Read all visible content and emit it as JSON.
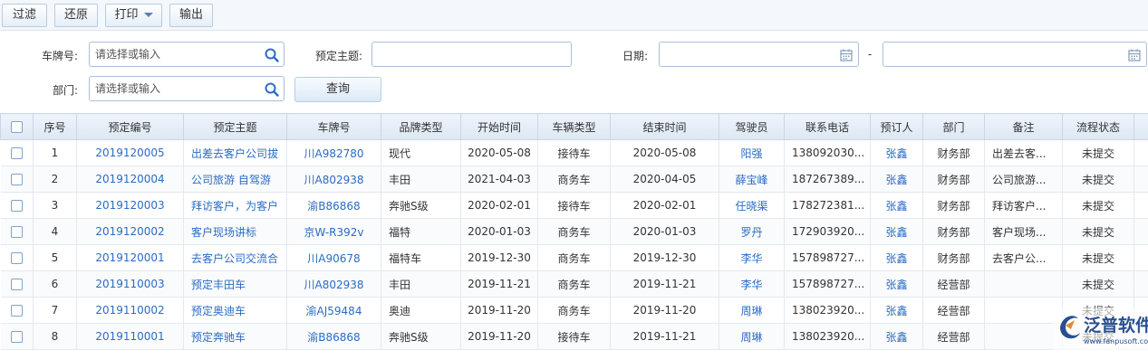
{
  "toolbar": {
    "filter_label": "过滤",
    "restore_label": "还原",
    "print_label": "打印",
    "export_label": "输出"
  },
  "filters": {
    "plate_label": "车牌号:",
    "plate_placeholder": "请选择或输入",
    "subject_label": "预定主题:",
    "subject_value": "",
    "date_label": "日期:",
    "date_separator": "-",
    "date_from": "",
    "date_to": "",
    "dept_label": "部门:",
    "dept_placeholder": "请选择或输入",
    "query_label": "查询"
  },
  "table": {
    "columns": [
      "序号",
      "预定编号",
      "预定主题",
      "车牌号",
      "品牌类型",
      "开始时间",
      "车辆类型",
      "结束时间",
      "驾驶员",
      "联系电话",
      "预订人",
      "部门",
      "备注",
      "流程状态"
    ],
    "rows": [
      {
        "no": "1",
        "code": "2019120005",
        "subject": "出差去客户公司拔",
        "plate": "川A982780",
        "brand": "现代",
        "start": "2020-05-08",
        "vtype": "接待车",
        "end": "2020-05-08",
        "driver": "阳强",
        "phone": "138092030...",
        "booker": "张鑫",
        "dept": "财务部",
        "note": "出差去客...",
        "status": "未提交"
      },
      {
        "no": "2",
        "code": "2019120004",
        "subject": "公司旅游 自驾游",
        "plate": "川A802938",
        "brand": "丰田",
        "start": "2021-04-03",
        "vtype": "商务车",
        "end": "2020-04-05",
        "driver": "薛宝峰",
        "phone": "187267389...",
        "booker": "张鑫",
        "dept": "财务部",
        "note": "公司旅游...",
        "status": "未提交"
      },
      {
        "no": "3",
        "code": "2019120003",
        "subject": "拜访客户，为客户",
        "plate": "渝B86868",
        "brand": "奔驰S级",
        "start": "2020-02-01",
        "vtype": "接待车",
        "end": "2020-02-01",
        "driver": "任晓渠",
        "phone": "178272381...",
        "booker": "张鑫",
        "dept": "财务部",
        "note": "拜访客户...",
        "status": "未提交"
      },
      {
        "no": "4",
        "code": "2019120002",
        "subject": "客户现场讲标",
        "plate": "京W-R392v",
        "brand": "福特",
        "start": "2020-01-03",
        "vtype": "商务车",
        "end": "2020-01-03",
        "driver": "罗丹",
        "phone": "172903920...",
        "booker": "张鑫",
        "dept": "财务部",
        "note": "客户现场...",
        "status": "未提交"
      },
      {
        "no": "5",
        "code": "2019120001",
        "subject": "去客户公司交流合",
        "plate": "川A90678",
        "brand": "福特车",
        "start": "2019-12-30",
        "vtype": "商务车",
        "end": "2019-12-30",
        "driver": "李华",
        "phone": "157898727...",
        "booker": "张鑫",
        "dept": "财务部",
        "note": "去客户公...",
        "status": "未提交"
      },
      {
        "no": "6",
        "code": "2019110003",
        "subject": "预定丰田车",
        "plate": "川A802938",
        "brand": "丰田",
        "start": "2019-11-21",
        "vtype": "商务车",
        "end": "2019-11-21",
        "driver": "李华",
        "phone": "157898727...",
        "booker": "张鑫",
        "dept": "经营部",
        "note": "",
        "status": "未提交"
      },
      {
        "no": "7",
        "code": "2019110002",
        "subject": "预定奥迪车",
        "plate": "渝AJ59484",
        "brand": "奥迪",
        "start": "2019-11-20",
        "vtype": "商务车",
        "end": "2019-11-20",
        "driver": "周琳",
        "phone": "138023920...",
        "booker": "张鑫",
        "dept": "经营部",
        "note": "",
        "status": "未提交"
      },
      {
        "no": "8",
        "code": "2019110001",
        "subject": "预定奔驰车",
        "plate": "渝B86868",
        "brand": "奔驰S级",
        "start": "2019-11-20",
        "vtype": "接待车",
        "end": "2019-11-21",
        "driver": "周琳",
        "phone": "138023920...",
        "booker": "张鑫",
        "dept": "经营部",
        "note": "",
        "status": "未提交"
      }
    ]
  },
  "logo": {
    "text": "泛普软件",
    "url_text": "www.fanpusoft.com",
    "color": "#2a4f8f"
  },
  "colors": {
    "link": "#2a6cc5",
    "header_bg": "#dde8f4",
    "border": "#a9c0d8"
  }
}
